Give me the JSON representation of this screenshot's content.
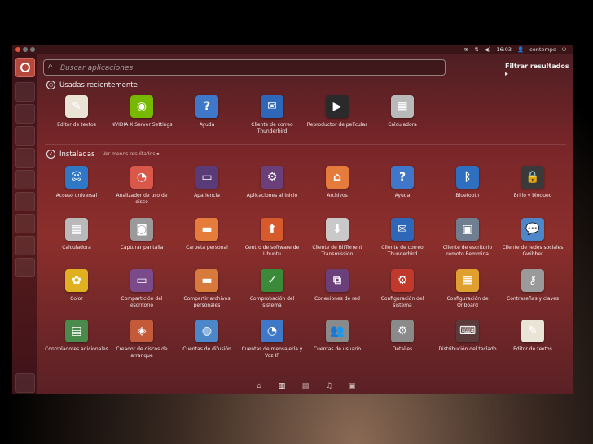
{
  "panel": {
    "time": "16:03",
    "user": "contempe",
    "colors": {
      "close": "#e0533a",
      "min": "#777777",
      "max": "#777777"
    }
  },
  "search": {
    "placeholder": "Buscar aplicaciones"
  },
  "filter_label": "Filtrar resultados ▸",
  "sections": {
    "recent": {
      "title": "Usadas recientemente"
    },
    "installed": {
      "title": "Instaladas",
      "more": "Ver menos resultados ▾"
    }
  },
  "recent_apps": [
    {
      "label": "Editor de textos",
      "icon": "text-editor-icon",
      "color": "#e9e4d6",
      "glyph": "✎"
    },
    {
      "label": "NVIDIA X Server Settings",
      "icon": "nvidia-icon",
      "color": "#76b900",
      "glyph": "◉"
    },
    {
      "label": "Ayuda",
      "icon": "help-icon",
      "color": "#3f78c8",
      "glyph": "?"
    },
    {
      "label": "Cliente de correo Thunderbird",
      "icon": "thunderbird-icon",
      "color": "#2f67b8",
      "glyph": "✉"
    },
    {
      "label": "Reproductor de películas",
      "icon": "movie-player-icon",
      "color": "#2a2a2a",
      "glyph": "▶"
    },
    {
      "label": "Calculadora",
      "icon": "calculator-icon",
      "color": "#b9b9b9",
      "glyph": "▦"
    }
  ],
  "installed_apps": [
    {
      "label": "Acceso universal",
      "icon": "accessibility-icon",
      "color": "#2f78c6",
      "glyph": "☺"
    },
    {
      "label": "Analizador de uso de disco",
      "icon": "disk-usage-icon",
      "color": "#d9584a",
      "glyph": "◔"
    },
    {
      "label": "Apariencia",
      "icon": "appearance-icon",
      "color": "#5b3a78",
      "glyph": "▭"
    },
    {
      "label": "Aplicaciones al inicio",
      "icon": "startup-apps-icon",
      "color": "#6a3f7a",
      "glyph": "⚙"
    },
    {
      "label": "Archivos",
      "icon": "files-icon",
      "color": "#e67c3c",
      "glyph": "⌂"
    },
    {
      "label": "Ayuda",
      "icon": "help-icon",
      "color": "#3f78c8",
      "glyph": "?"
    },
    {
      "label": "Bluetooth",
      "icon": "bluetooth-icon",
      "color": "#2f6fbf",
      "glyph": "ᛒ"
    },
    {
      "label": "Brillo y bloqueo",
      "icon": "lock-screen-icon",
      "color": "#3a3a3a",
      "glyph": "🔒"
    },
    {
      "label": "Calculadora",
      "icon": "calculator-icon",
      "color": "#b9b9b9",
      "glyph": "▦"
    },
    {
      "label": "Capturar pantalla",
      "icon": "screenshot-icon",
      "color": "#9a9a9a",
      "glyph": "◙"
    },
    {
      "label": "Carpeta personal",
      "icon": "home-folder-icon",
      "color": "#e67c3c",
      "glyph": "▬"
    },
    {
      "label": "Centro de software de Ubuntu",
      "icon": "software-center-icon",
      "color": "#d65a2c",
      "glyph": "⬆"
    },
    {
      "label": "Cliente de BitTorrent Transmission",
      "icon": "transmission-icon",
      "color": "#c9c9c9",
      "glyph": "⬇"
    },
    {
      "label": "Cliente de correo Thunderbird",
      "icon": "thunderbird-icon",
      "color": "#2f67b8",
      "glyph": "✉"
    },
    {
      "label": "Cliente de escritorio remoto Remmina",
      "icon": "remmina-icon",
      "color": "#6f7f8f",
      "glyph": "▣"
    },
    {
      "label": "Cliente de redes sociales Gwibber",
      "icon": "gwibber-icon",
      "color": "#4b87c9",
      "glyph": "💬"
    },
    {
      "label": "Color",
      "icon": "color-icon",
      "color": "#e0b020",
      "glyph": "✿"
    },
    {
      "label": "Compartición del escritorio",
      "icon": "desktop-sharing-icon",
      "color": "#7a4a8a",
      "glyph": "▭"
    },
    {
      "label": "Compartir archivos personales",
      "icon": "share-files-icon",
      "color": "#d87a3c",
      "glyph": "▬"
    },
    {
      "label": "Comprobación del sistema",
      "icon": "system-check-icon",
      "color": "#3a8a3a",
      "glyph": "✓"
    },
    {
      "label": "Conexiones de red",
      "icon": "network-icon",
      "color": "#6a3f7a",
      "glyph": "⧉"
    },
    {
      "label": "Configuración del sistema",
      "icon": "system-settings-icon",
      "color": "#c0392b",
      "glyph": "⚙"
    },
    {
      "label": "Configuración de Onboard",
      "icon": "onboard-icon",
      "color": "#e0a030",
      "glyph": "▦"
    },
    {
      "label": "Contraseñas y claves",
      "icon": "keys-icon",
      "color": "#9a9a9a",
      "glyph": "⚷"
    },
    {
      "label": "Controladores adicionales",
      "icon": "drivers-icon",
      "color": "#4a8a4a",
      "glyph": "▤"
    },
    {
      "label": "Creador de discos de arranque",
      "icon": "startup-disk-icon",
      "color": "#c55a3a",
      "glyph": "◈"
    },
    {
      "label": "Cuentas de difusión",
      "icon": "broadcast-icon",
      "color": "#4b87c9",
      "glyph": "◍"
    },
    {
      "label": "Cuentas de mensajería y Voz IP",
      "icon": "messaging-icon",
      "color": "#3f78c8",
      "glyph": "◔"
    },
    {
      "label": "Cuentas de usuario",
      "icon": "users-icon",
      "color": "#8a8a8a",
      "glyph": "👥"
    },
    {
      "label": "Detalles",
      "icon": "details-icon",
      "color": "#8a8a8a",
      "glyph": "⚙"
    },
    {
      "label": "Distribución del teclado",
      "icon": "keyboard-icon",
      "color": "#5a3a3a",
      "glyph": "⌨"
    },
    {
      "label": "Editor de textos",
      "icon": "text-editor-icon",
      "color": "#e9e4d6",
      "glyph": "✎"
    }
  ],
  "lenses": [
    "home-lens-icon",
    "apps-lens-icon",
    "files-lens-icon",
    "music-lens-icon",
    "video-lens-icon"
  ]
}
